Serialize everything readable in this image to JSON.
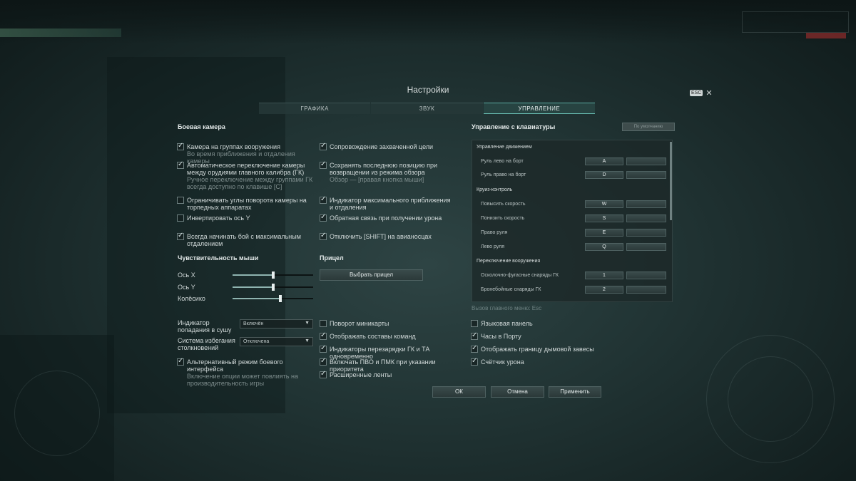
{
  "window": {
    "title": "Настройки",
    "esc_key": "ESC",
    "close_icon": "✕"
  },
  "tabs": [
    {
      "label": "ГРАФИКА",
      "active": false
    },
    {
      "label": "ЗВУК",
      "active": false
    },
    {
      "label": "УПРАВЛЕНИЕ",
      "active": true
    }
  ],
  "battle_camera": {
    "title": "Боевая камера",
    "left": [
      {
        "label": "Камера на группах вооружения",
        "sub": "Во время приближения и отдаления камеры",
        "checked": true
      },
      {
        "label": "Автоматическое переключение камеры между орудиями главного калибра (ГК)",
        "sub": "Ручное переключение между группами ГК всегда доступно по клавише [C]",
        "checked": true
      },
      {
        "label": "Ограничивать углы поворота камеры на торпедных аппаратах",
        "sub": "",
        "checked": false
      },
      {
        "label": "Инвертировать ось Y",
        "sub": "",
        "checked": false
      },
      {
        "label": "Всегда начинать бой с максимальным отдалением",
        "sub": "",
        "checked": true
      }
    ],
    "right": [
      {
        "label": "Сопровождение захваченной цели",
        "sub": "",
        "checked": true
      },
      {
        "label": "Сохранять последнюю позицию при возвращении из режима обзора",
        "sub": "Обзор — [правая кнопка мыши]",
        "checked": true
      },
      {
        "label": "Индикатор максимального приближения и отдаления",
        "sub": "",
        "checked": true
      },
      {
        "label": "Обратная связь при получении урона",
        "sub": "",
        "checked": true
      },
      {
        "label": "Отключить [SHIFT] на авианосцах",
        "sub": "",
        "checked": true
      }
    ]
  },
  "mouse": {
    "title": "Чувствительность мыши",
    "sliders": [
      {
        "label": "Ось X",
        "value": 0.5
      },
      {
        "label": "Ось Y",
        "value": 0.5
      },
      {
        "label": "Колёсико",
        "value": 0.59
      }
    ]
  },
  "sight": {
    "title": "Прицел",
    "button": "Выбрать прицел"
  },
  "selects": [
    {
      "label": "Индикатор попадания в сушу",
      "value": "Включён"
    },
    {
      "label": "Система избегания столкновений",
      "value": "Отключена"
    }
  ],
  "alt_mode": {
    "label": "Альтернативный режим боевого интерфейса",
    "sub": "Включение опции может повлиять на производительность игры",
    "checked": true
  },
  "misc_middle": [
    {
      "label": "Поворот миникарты",
      "checked": false
    },
    {
      "label": "Отображать составы команд",
      "checked": true
    },
    {
      "label": "Индикаторы перезарядки ГК и ТА одновременно",
      "checked": true
    },
    {
      "label": "Включать ПВО и ПМК при указании приоритета",
      "checked": true
    },
    {
      "label": "Расширенные ленты",
      "checked": true
    }
  ],
  "misc_right": [
    {
      "label": "Языковая панель",
      "checked": false
    },
    {
      "label": "Часы в Порту",
      "checked": true
    },
    {
      "label": "Отображать границу дымовой завесы",
      "checked": true
    },
    {
      "label": "Счётчик урона",
      "checked": true
    }
  ],
  "keyboard": {
    "title": "Управление с клавиатуры",
    "reset_button": "По умолчанию",
    "hint": "Вызов главного меню: Esc",
    "rows": [
      {
        "kind": "cat",
        "label": "Управление движением"
      },
      {
        "kind": "item",
        "label": "Руль лево на борт",
        "key": "A"
      },
      {
        "kind": "item",
        "label": "Руль право на борт",
        "key": "D"
      },
      {
        "kind": "cat",
        "label": "Круиз-контроль"
      },
      {
        "kind": "item",
        "label": "Повысить скорость",
        "key": "W"
      },
      {
        "kind": "item",
        "label": "Понизить скорость",
        "key": "S"
      },
      {
        "kind": "item",
        "label": "Право руля",
        "key": "E"
      },
      {
        "kind": "item",
        "label": "Лево руля",
        "key": "Q"
      },
      {
        "kind": "cat",
        "label": "Переключение вооружения"
      },
      {
        "kind": "item",
        "label": "Осколочно-фугасные снаряды ГК",
        "key": "1"
      },
      {
        "kind": "item",
        "label": "Бронебойные снаряды ГК",
        "key": "2"
      }
    ]
  },
  "footer": {
    "ok": "ОК",
    "cancel": "Отмена",
    "apply": "Применить"
  },
  "icons": {
    "check": "check-icon",
    "dropdown": "chevron-down-icon",
    "close": "close-icon"
  }
}
